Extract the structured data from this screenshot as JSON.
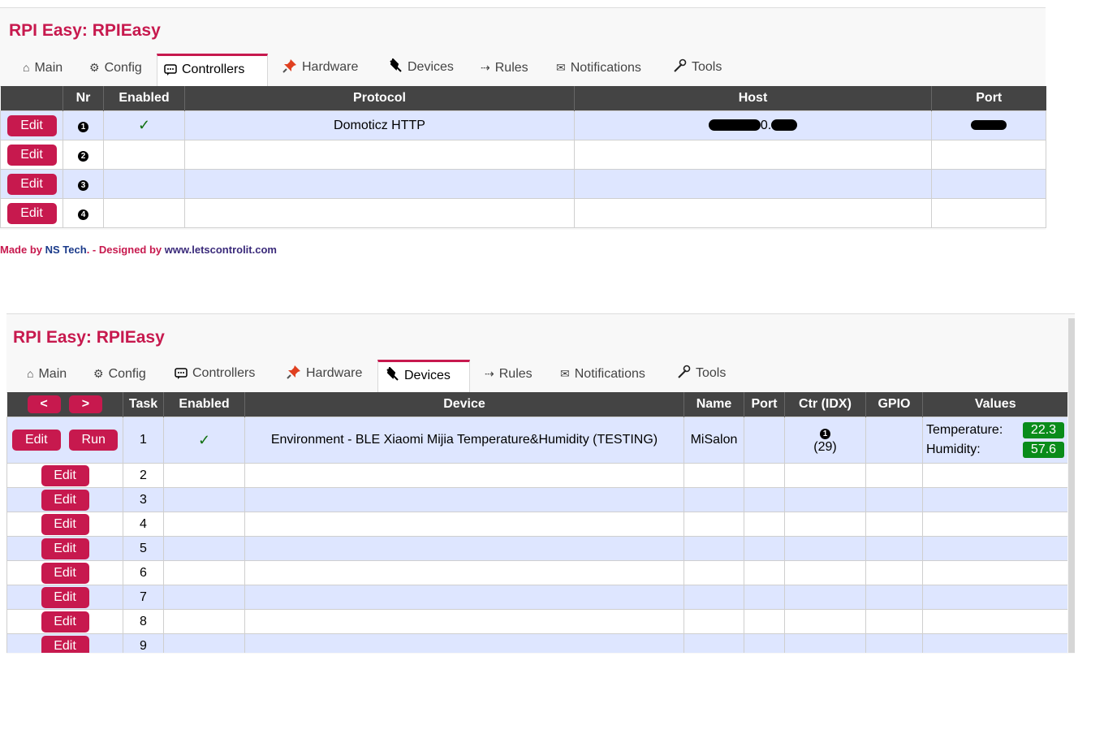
{
  "screen1": {
    "title": "RPI Easy: RPIEasy",
    "tabs": [
      {
        "label": "Main",
        "icon": "home-icon"
      },
      {
        "label": "Config",
        "icon": "gear-icon"
      },
      {
        "label": "Controllers",
        "icon": "chat-icon"
      },
      {
        "label": "Hardware",
        "icon": "pushpin-icon"
      },
      {
        "label": "Devices",
        "icon": "plug-icon"
      },
      {
        "label": "Rules",
        "icon": "arrow-icon"
      },
      {
        "label": "Notifications",
        "icon": "envelope-icon"
      },
      {
        "label": "Tools",
        "icon": "wrench-icon"
      }
    ],
    "active_tab": "Controllers",
    "table": {
      "headers": [
        "",
        "Nr",
        "Enabled",
        "Protocol",
        "Host",
        "Port"
      ],
      "rows": [
        {
          "edit": "Edit",
          "nr": "1",
          "enabled": "✓",
          "protocol": "Domoticz HTTP",
          "host_fragment": "0."
        },
        {
          "edit": "Edit",
          "nr": "2",
          "enabled": "",
          "protocol": ""
        },
        {
          "edit": "Edit",
          "nr": "3",
          "enabled": "",
          "protocol": ""
        },
        {
          "edit": "Edit",
          "nr": "4",
          "enabled": "",
          "protocol": ""
        }
      ]
    },
    "footer": {
      "made_by": "Made by ",
      "ns_tech": "NS Tech",
      "designed_by": ". - Designed by ",
      "site": "www.letscontrolit.com"
    }
  },
  "screen2": {
    "title": "RPI Easy: RPIEasy",
    "tabs": [
      {
        "label": "Main",
        "icon": "home-icon"
      },
      {
        "label": "Config",
        "icon": "gear-icon"
      },
      {
        "label": "Controllers",
        "icon": "chat-icon"
      },
      {
        "label": "Hardware",
        "icon": "pushpin-icon"
      },
      {
        "label": "Devices",
        "icon": "plug-icon"
      },
      {
        "label": "Rules",
        "icon": "arrow-icon"
      },
      {
        "label": "Notifications",
        "icon": "envelope-icon"
      },
      {
        "label": "Tools",
        "icon": "wrench-icon"
      }
    ],
    "active_tab": "Devices",
    "nav": {
      "prev": "<",
      "next": ">"
    },
    "table": {
      "headers": [
        "Task",
        "Enabled",
        "Device",
        "Name",
        "Port",
        "Ctr (IDX)",
        "GPIO",
        "Values"
      ],
      "first_row": {
        "edit": "Edit",
        "run": "Run",
        "task": "1",
        "enabled": "✓",
        "device": "Environment - BLE Xiaomi Mijia Temperature&Humidity (TESTING)",
        "name": "MiSalon",
        "ctr_num": "1",
        "ctr_idx": "(29)",
        "values": [
          {
            "label": "Temperature:",
            "value": "22.3"
          },
          {
            "label": "Humidity:",
            "value": "57.6"
          }
        ]
      },
      "rows": [
        {
          "edit": "Edit",
          "task": "2"
        },
        {
          "edit": "Edit",
          "task": "3"
        },
        {
          "edit": "Edit",
          "task": "4"
        },
        {
          "edit": "Edit",
          "task": "5"
        },
        {
          "edit": "Edit",
          "task": "6"
        },
        {
          "edit": "Edit",
          "task": "7"
        },
        {
          "edit": "Edit",
          "task": "8"
        },
        {
          "edit": "Edit",
          "task": "9"
        }
      ]
    }
  },
  "colors": {
    "accent": "#c7194e",
    "header_bg": "#444444",
    "row_alt": "#dee6ff",
    "value_bg": "#098c1a"
  }
}
